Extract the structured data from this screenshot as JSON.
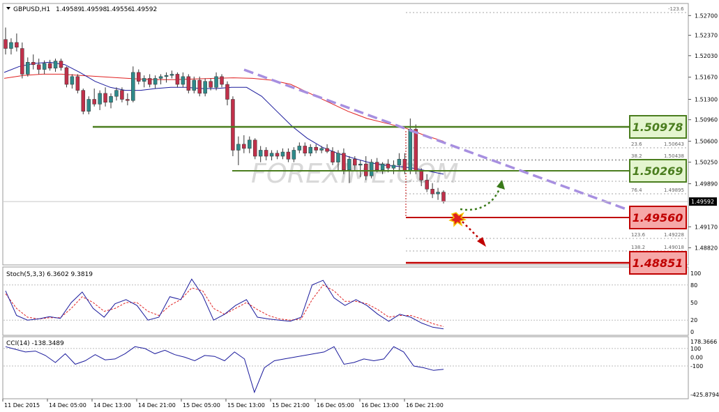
{
  "header": {
    "symbol": "GBPUSD,H1",
    "open": "1.49589",
    "high": "1.49598",
    "low": "1.49556",
    "close": "1.49592"
  },
  "price_axis": {
    "labels": [
      "1.52700",
      "1.52370",
      "1.52030",
      "1.51670",
      "1.51300",
      "1.50960",
      "1.50600",
      "1.50250",
      "1.49890"
    ],
    "labels_lower": [
      "1.49170",
      "1.48820"
    ],
    "current_price": "1.49592",
    "current_price_2": "1.49556"
  },
  "fib": {
    "top_label": "-123.6",
    "levels": [
      {
        "ratio": "23.6",
        "price": "1.50643"
      },
      {
        "ratio": "38.2",
        "price": "1.50438"
      },
      {
        "ratio": "76.4",
        "price": "1.49895"
      },
      {
        "ratio": "123.6",
        "price": "1.49228"
      },
      {
        "ratio": "138.2",
        "price": "1.49018"
      }
    ]
  },
  "levels": {
    "resistance_1": "1.50978",
    "resistance_2": "1.50269",
    "support_1": "1.49560",
    "support_2": "1.48851"
  },
  "colors": {
    "resistance": "#4a7d1e",
    "resistance_box": "#e4f5cf",
    "support": "#c00000",
    "support_box": "#f6a8a8",
    "trendline": "#a78fe0",
    "ma_fast": "#1a1a9c",
    "ma_slow": "#e02020",
    "candle_bull": "#2e8a8a",
    "candle_bear": "#c0304a"
  },
  "watermark": "FOREXIME.COM",
  "stoch": {
    "label": "Stoch(5,3,3) 6.3602 9.3819",
    "axis": [
      "100",
      "80",
      "50",
      "20",
      "0"
    ]
  },
  "cci": {
    "label": "CCI(14) -138.3489",
    "axis": [
      "178.3666",
      "100",
      "0.00",
      "-100",
      "-425.8794"
    ]
  },
  "time_axis": [
    "11 Dec 2015",
    "14 Dec 05:00",
    "14 Dec 13:00",
    "14 Dec 21:00",
    "15 Dec 05:00",
    "15 Dec 13:00",
    "15 Dec 21:00",
    "16 Dec 05:00",
    "16 Dec 13:00",
    "16 Dec 21:00"
  ],
  "chart_data": {
    "type": "candlestick",
    "symbol": "GBPUSD",
    "timeframe": "H1",
    "ylim": [
      1.4865,
      1.5282
    ],
    "candles": [
      {
        "o": 1.523,
        "h": 1.525,
        "l": 1.5205,
        "c": 1.5215
      },
      {
        "o": 1.5215,
        "h": 1.5232,
        "l": 1.5205,
        "c": 1.5225
      },
      {
        "o": 1.5225,
        "h": 1.524,
        "l": 1.521,
        "c": 1.5217
      },
      {
        "o": 1.5215,
        "h": 1.5225,
        "l": 1.5165,
        "c": 1.5172
      },
      {
        "o": 1.5172,
        "h": 1.52,
        "l": 1.5168,
        "c": 1.5192
      },
      {
        "o": 1.5192,
        "h": 1.5205,
        "l": 1.518,
        "c": 1.5188
      },
      {
        "o": 1.5188,
        "h": 1.5198,
        "l": 1.5172,
        "c": 1.518
      },
      {
        "o": 1.518,
        "h": 1.5195,
        "l": 1.5172,
        "c": 1.519
      },
      {
        "o": 1.519,
        "h": 1.5196,
        "l": 1.5178,
        "c": 1.5182
      },
      {
        "o": 1.5182,
        "h": 1.5198,
        "l": 1.5176,
        "c": 1.5194
      },
      {
        "o": 1.5194,
        "h": 1.5198,
        "l": 1.5178,
        "c": 1.5183
      },
      {
        "o": 1.5183,
        "h": 1.5185,
        "l": 1.515,
        "c": 1.5155
      },
      {
        "o": 1.5155,
        "h": 1.5172,
        "l": 1.5148,
        "c": 1.5168
      },
      {
        "o": 1.5168,
        "h": 1.5172,
        "l": 1.514,
        "c": 1.5145
      },
      {
        "o": 1.5145,
        "h": 1.5148,
        "l": 1.5105,
        "c": 1.511
      },
      {
        "o": 1.511,
        "h": 1.5135,
        "l": 1.5105,
        "c": 1.513
      },
      {
        "o": 1.513,
        "h": 1.5148,
        "l": 1.5118,
        "c": 1.5122
      },
      {
        "o": 1.5122,
        "h": 1.5145,
        "l": 1.5112,
        "c": 1.514
      },
      {
        "o": 1.514,
        "h": 1.515,
        "l": 1.5118,
        "c": 1.5125
      },
      {
        "o": 1.5125,
        "h": 1.514,
        "l": 1.5115,
        "c": 1.5135
      },
      {
        "o": 1.5135,
        "h": 1.515,
        "l": 1.5128,
        "c": 1.5145
      },
      {
        "o": 1.5145,
        "h": 1.515,
        "l": 1.5125,
        "c": 1.513
      },
      {
        "o": 1.513,
        "h": 1.514,
        "l": 1.512,
        "c": 1.5128
      },
      {
        "o": 1.5128,
        "h": 1.5185,
        "l": 1.5125,
        "c": 1.5175
      },
      {
        "o": 1.5175,
        "h": 1.518,
        "l": 1.5155,
        "c": 1.516
      },
      {
        "o": 1.516,
        "h": 1.517,
        "l": 1.515,
        "c": 1.5165
      },
      {
        "o": 1.5165,
        "h": 1.5172,
        "l": 1.515,
        "c": 1.5155
      },
      {
        "o": 1.5155,
        "h": 1.517,
        "l": 1.5148,
        "c": 1.5165
      },
      {
        "o": 1.5165,
        "h": 1.5172,
        "l": 1.5155,
        "c": 1.5168
      },
      {
        "o": 1.5168,
        "h": 1.5175,
        "l": 1.5158,
        "c": 1.517
      },
      {
        "o": 1.517,
        "h": 1.5178,
        "l": 1.5165,
        "c": 1.5172
      },
      {
        "o": 1.5172,
        "h": 1.5175,
        "l": 1.515,
        "c": 1.5155
      },
      {
        "o": 1.5155,
        "h": 1.5175,
        "l": 1.515,
        "c": 1.5168
      },
      {
        "o": 1.5168,
        "h": 1.5172,
        "l": 1.514,
        "c": 1.5145
      },
      {
        "o": 1.5145,
        "h": 1.5168,
        "l": 1.514,
        "c": 1.5162
      },
      {
        "o": 1.5162,
        "h": 1.5168,
        "l": 1.5135,
        "c": 1.514
      },
      {
        "o": 1.514,
        "h": 1.5165,
        "l": 1.5135,
        "c": 1.516
      },
      {
        "o": 1.516,
        "h": 1.5165,
        "l": 1.5145,
        "c": 1.515
      },
      {
        "o": 1.515,
        "h": 1.5175,
        "l": 1.5145,
        "c": 1.5168
      },
      {
        "o": 1.5168,
        "h": 1.5172,
        "l": 1.515,
        "c": 1.5155
      },
      {
        "o": 1.5155,
        "h": 1.516,
        "l": 1.512,
        "c": 1.513
      },
      {
        "o": 1.513,
        "h": 1.5135,
        "l": 1.5035,
        "c": 1.5045
      },
      {
        "o": 1.5045,
        "h": 1.5068,
        "l": 1.502,
        "c": 1.5055
      },
      {
        "o": 1.5055,
        "h": 1.507,
        "l": 1.504,
        "c": 1.5048
      },
      {
        "o": 1.5048,
        "h": 1.5068,
        "l": 1.504,
        "c": 1.5062
      },
      {
        "o": 1.5062,
        "h": 1.5065,
        "l": 1.503,
        "c": 1.5035
      },
      {
        "o": 1.5035,
        "h": 1.5052,
        "l": 1.5025,
        "c": 1.5045
      },
      {
        "o": 1.5045,
        "h": 1.505,
        "l": 1.5028,
        "c": 1.5035
      },
      {
        "o": 1.5035,
        "h": 1.5045,
        "l": 1.5028,
        "c": 1.504
      },
      {
        "o": 1.504,
        "h": 1.5045,
        "l": 1.503,
        "c": 1.5035
      },
      {
        "o": 1.5035,
        "h": 1.5048,
        "l": 1.503,
        "c": 1.5042
      },
      {
        "o": 1.5042,
        "h": 1.5048,
        "l": 1.5025,
        "c": 1.503
      },
      {
        "o": 1.503,
        "h": 1.505,
        "l": 1.5025,
        "c": 1.5045
      },
      {
        "o": 1.5045,
        "h": 1.5058,
        "l": 1.504,
        "c": 1.5052
      },
      {
        "o": 1.5052,
        "h": 1.5058,
        "l": 1.5035,
        "c": 1.504
      },
      {
        "o": 1.504,
        "h": 1.5055,
        "l": 1.5035,
        "c": 1.505
      },
      {
        "o": 1.505,
        "h": 1.5055,
        "l": 1.504,
        "c": 1.5045
      },
      {
        "o": 1.5045,
        "h": 1.5052,
        "l": 1.504,
        "c": 1.5048
      },
      {
        "o": 1.5048,
        "h": 1.5055,
        "l": 1.504,
        "c": 1.5043
      },
      {
        "o": 1.5043,
        "h": 1.505,
        "l": 1.502,
        "c": 1.5025
      },
      {
        "o": 1.5025,
        "h": 1.5045,
        "l": 1.501,
        "c": 1.504
      },
      {
        "o": 1.504,
        "h": 1.5048,
        "l": 1.5005,
        "c": 1.5012
      },
      {
        "o": 1.5012,
        "h": 1.5035,
        "l": 1.499,
        "c": 1.503
      },
      {
        "o": 1.503,
        "h": 1.5035,
        "l": 1.501,
        "c": 1.502
      },
      {
        "o": 1.502,
        "h": 1.5028,
        "l": 1.5,
        "c": 1.5022
      },
      {
        "o": 1.5022,
        "h": 1.5035,
        "l": 1.4995,
        "c": 1.5002
      },
      {
        "o": 1.5002,
        "h": 1.503,
        "l": 1.4998,
        "c": 1.5025
      },
      {
        "o": 1.5025,
        "h": 1.5032,
        "l": 1.5008,
        "c": 1.5012
      },
      {
        "o": 1.5012,
        "h": 1.5025,
        "l": 1.5005,
        "c": 1.5022
      },
      {
        "o": 1.5022,
        "h": 1.503,
        "l": 1.5008,
        "c": 1.5015
      },
      {
        "o": 1.5015,
        "h": 1.5028,
        "l": 1.5005,
        "c": 1.502
      },
      {
        "o": 1.502,
        "h": 1.504,
        "l": 1.501,
        "c": 1.503
      },
      {
        "o": 1.503,
        "h": 1.504,
        "l": 1.5005,
        "c": 1.501
      },
      {
        "o": 1.501,
        "h": 1.5098,
        "l": 1.5005,
        "c": 1.508
      },
      {
        "o": 1.508,
        "h": 1.5088,
        "l": 1.5005,
        "c": 1.501
      },
      {
        "o": 1.501,
        "h": 1.5015,
        "l": 1.4985,
        "c": 1.4995
      },
      {
        "o": 1.4995,
        "h": 1.5005,
        "l": 1.4975,
        "c": 1.498
      },
      {
        "o": 1.498,
        "h": 1.499,
        "l": 1.4965,
        "c": 1.4972
      },
      {
        "o": 1.4972,
        "h": 1.4982,
        "l": 1.4962,
        "c": 1.4975
      },
      {
        "o": 1.4975,
        "h": 1.4978,
        "l": 1.4956,
        "c": 1.4959
      }
    ],
    "ma_fast": [
      1.5175,
      1.5185,
      1.519,
      1.5192,
      1.5188,
      1.5175,
      1.516,
      1.515,
      1.5145,
      1.5145,
      1.5148,
      1.515,
      1.515,
      1.5148,
      1.5148,
      1.515,
      1.515,
      1.5135,
      1.511,
      1.5085,
      1.5065,
      1.505,
      1.504,
      1.5032,
      1.5025,
      1.502,
      1.5018,
      1.5015,
      1.501,
      1.5005
    ],
    "ma_slow": [
      1.5165,
      1.517,
      1.5172,
      1.5172,
      1.517,
      1.5168,
      1.5166,
      1.5164,
      1.5163,
      1.5163,
      1.5164,
      1.5165,
      1.5166,
      1.5165,
      1.5162,
      1.5155,
      1.514,
      1.5125,
      1.511,
      1.5098,
      1.509,
      1.5082,
      1.507,
      1.506
    ],
    "stoch_main": [
      70,
      28,
      20,
      22,
      26,
      23,
      50,
      68,
      40,
      25,
      48,
      55,
      45,
      20,
      25,
      60,
      55,
      90,
      62,
      20,
      30,
      45,
      55,
      25,
      22,
      20,
      18,
      25,
      80,
      88,
      58,
      45,
      55,
      45,
      30,
      18,
      30,
      25,
      15,
      8,
      5
    ],
    "stoch_signal": [
      65,
      40,
      25,
      22,
      24,
      24,
      40,
      60,
      50,
      35,
      40,
      50,
      50,
      35,
      28,
      45,
      55,
      75,
      70,
      40,
      30,
      40,
      50,
      38,
      28,
      22,
      20,
      22,
      55,
      80,
      70,
      52,
      52,
      48,
      38,
      25,
      28,
      28,
      22,
      14,
      9
    ],
    "cci": [
      120,
      90,
      60,
      70,
      20,
      -60,
      40,
      -80,
      -40,
      30,
      -30,
      -20,
      40,
      120,
      100,
      40,
      80,
      30,
      0,
      -40,
      20,
      10,
      -40,
      60,
      -20,
      -400,
      -120,
      -40,
      -20,
      0,
      20,
      40,
      60,
      120,
      -80,
      -60,
      -20,
      -40,
      -20,
      120,
      60,
      -100,
      -120,
      -150,
      -138
    ],
    "horizontal_levels": [
      1.50978,
      1.50269,
      1.4956,
      1.48851
    ]
  }
}
